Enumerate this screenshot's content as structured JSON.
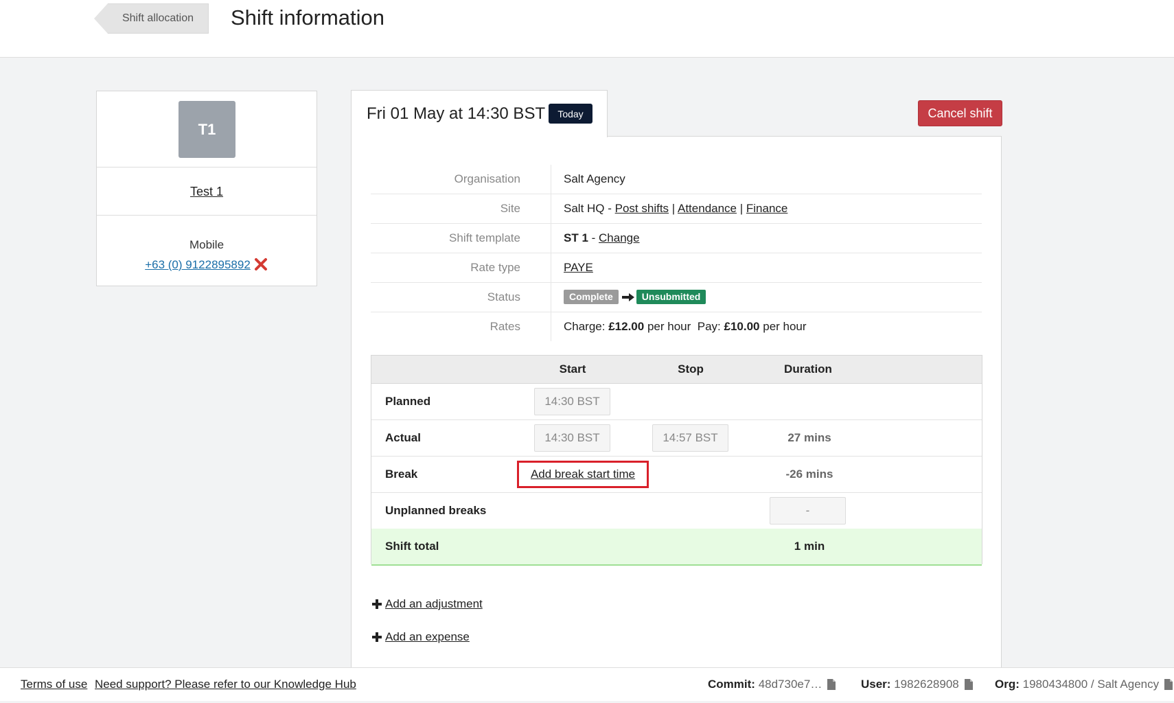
{
  "header": {
    "back_label": "Shift allocation",
    "title": "Shift information"
  },
  "profile": {
    "initials": "T1",
    "name": "Test 1",
    "mobile_label": "Mobile",
    "phone": "+63 (0) 9122895892"
  },
  "shift": {
    "date": "Fri 01 May at 14:30 BST",
    "today_badge": "Today",
    "cancel_label": "Cancel shift"
  },
  "info": {
    "organisation_label": "Organisation",
    "organisation": "Salt Agency",
    "site_label": "Site",
    "site_name": "Salt HQ",
    "site_sep": " - ",
    "site_links": [
      "Post shifts",
      "Attendance",
      "Finance"
    ],
    "pipe": " | ",
    "template_label": "Shift template",
    "template_code": "ST 1",
    "template_sep": " - ",
    "template_change": "Change",
    "rate_type_label": "Rate type",
    "rate_type": "PAYE",
    "status_label": "Status",
    "status_from": "Complete",
    "status_to": "Unsubmitted",
    "rates_label": "Rates",
    "charge_label": "Charge:",
    "charge_value": "£12.00",
    "per_hour": "per hour",
    "pay_label": "Pay:",
    "pay_value": "£10.00"
  },
  "times": {
    "headers": [
      "Start",
      "Stop",
      "Duration"
    ],
    "planned_label": "Planned",
    "planned_start": "14:30 BST",
    "actual_label": "Actual",
    "actual_start": "14:30 BST",
    "actual_stop": "14:57 BST",
    "actual_duration": "27 mins",
    "break_label": "Break",
    "break_link": "Add break start time",
    "break_duration": "-26 mins",
    "unplanned_label": "Unplanned breaks",
    "unplanned_value": "-",
    "total_label": "Shift total",
    "total_value": "1 min"
  },
  "actions": {
    "adjustment": "Add an adjustment",
    "expense": "Add an expense"
  },
  "footer": {
    "terms": "Terms of use",
    "support": "Need support? Please refer to our Knowledge Hub",
    "commit_label": "Commit:",
    "commit_value": "48d730e7…",
    "user_label": "User:",
    "user_value": "1982628908",
    "org_label": "Org:",
    "org_value": "1980434800 / Salt Agency"
  },
  "colors": {
    "cancel": "#c53d45",
    "today_badge": "#0d1b33",
    "status_complete": "#9a9a9a",
    "status_unsubmitted": "#1f8a5a",
    "highlight_box": "#d9202a",
    "total_row": "#e7fbe3"
  },
  "icons": [
    "remove-icon",
    "arrow-right-icon",
    "plus-icon",
    "document-icon"
  ]
}
